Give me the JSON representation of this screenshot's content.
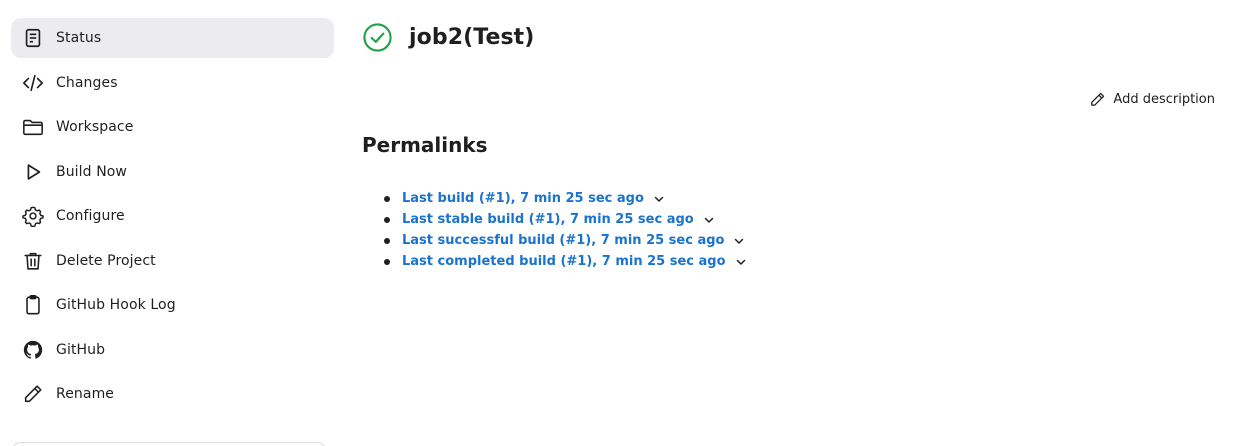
{
  "sidebar": {
    "items": [
      {
        "label": "Status",
        "icon": "document-icon",
        "active": true
      },
      {
        "label": "Changes",
        "icon": "code-icon"
      },
      {
        "label": "Workspace",
        "icon": "folder-icon"
      },
      {
        "label": "Build Now",
        "icon": "play-icon"
      },
      {
        "label": "Configure",
        "icon": "gear-icon"
      },
      {
        "label": "Delete Project",
        "icon": "trash-icon"
      },
      {
        "label": "GitHub Hook Log",
        "icon": "clipboard-icon"
      },
      {
        "label": "GitHub",
        "icon": "github-icon"
      },
      {
        "label": "Rename",
        "icon": "pencil-icon"
      }
    ]
  },
  "header": {
    "title": "job2(Test)",
    "status_icon": "success-check-icon",
    "status_color": "#1ea446"
  },
  "actions": {
    "add_description": "Add description"
  },
  "permalinks": {
    "title": "Permalinks",
    "items": [
      {
        "label": "Last build (#1), 7 min 25 sec ago"
      },
      {
        "label": "Last stable build (#1), 7 min 25 sec ago"
      },
      {
        "label": "Last successful build (#1), 7 min 25 sec ago"
      },
      {
        "label": "Last completed build (#1), 7 min 25 sec ago"
      }
    ]
  },
  "colors": {
    "link": "#1a73cc",
    "active_bg": "#ececf0"
  }
}
